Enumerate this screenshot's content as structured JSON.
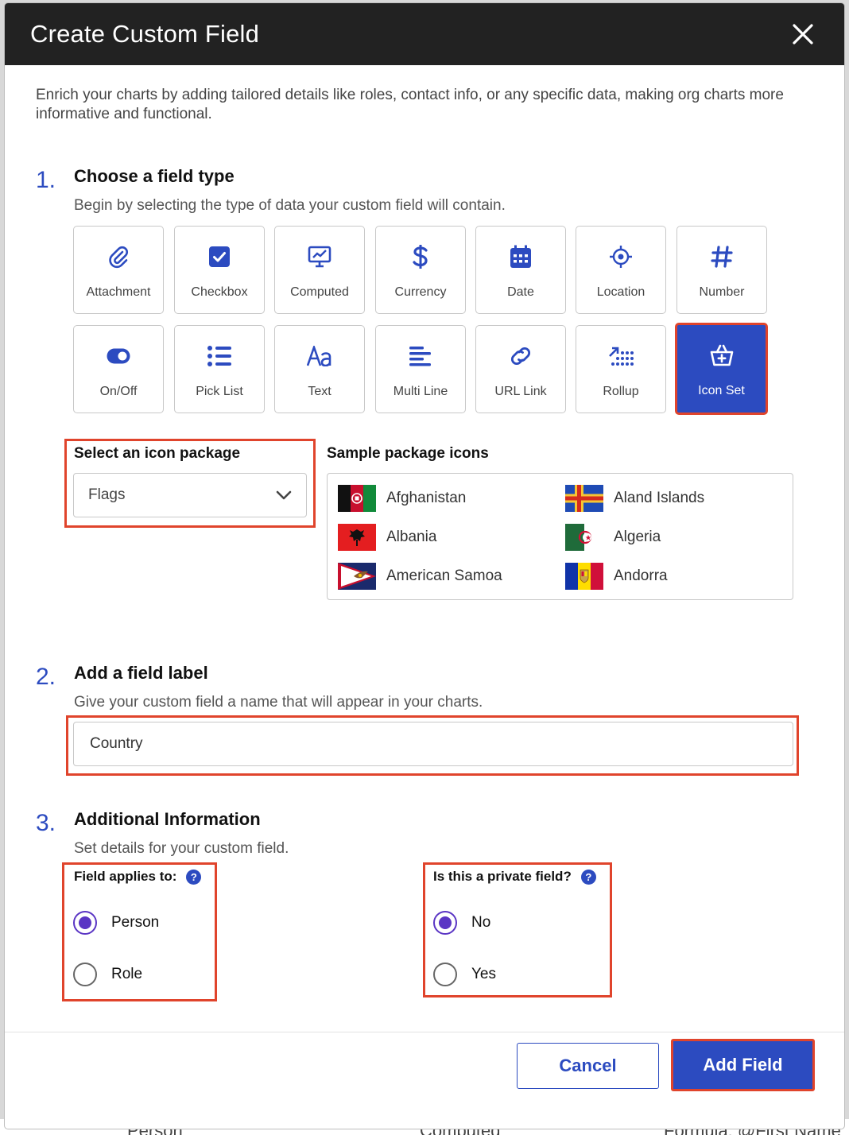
{
  "background": {
    "peek_left": "Person",
    "peek_mid": "Computed",
    "peek_right": "Formula: @First Name"
  },
  "modal": {
    "title": "Create Custom Field",
    "intro": "Enrich your charts by adding tailored details like roles, contact info, or any specific data, making org charts more informative and functional."
  },
  "step1": {
    "number": "1.",
    "title": "Choose a field type",
    "description": "Begin by selecting the type of data your custom field will contain.",
    "field_types": [
      {
        "label": "Attachment",
        "icon": "paperclip-icon"
      },
      {
        "label": "Checkbox",
        "icon": "checkbox-icon"
      },
      {
        "label": "Computed",
        "icon": "monitor-chart-icon"
      },
      {
        "label": "Currency",
        "icon": "dollar-icon"
      },
      {
        "label": "Date",
        "icon": "calendar-icon"
      },
      {
        "label": "Location",
        "icon": "crosshair-icon"
      },
      {
        "label": "Number",
        "icon": "hash-icon"
      },
      {
        "label": "On/Off",
        "icon": "toggle-icon"
      },
      {
        "label": "Pick List",
        "icon": "list-icon"
      },
      {
        "label": "Text",
        "icon": "text-aa-icon"
      },
      {
        "label": "Multi Line",
        "icon": "lines-icon"
      },
      {
        "label": "URL Link",
        "icon": "link-icon"
      },
      {
        "label": "Rollup",
        "icon": "rollup-icon"
      },
      {
        "label": "Icon Set",
        "icon": "basket-icon"
      }
    ],
    "selected_type": "Icon Set",
    "icon_package_label": "Select an icon package",
    "icon_package_value": "Flags",
    "sample_label": "Sample package icons",
    "sample_icons": [
      {
        "name": "Afghanistan",
        "icon": "flag-afghanistan-icon"
      },
      {
        "name": "Aland Islands",
        "icon": "flag-aland-icon"
      },
      {
        "name": "Albania",
        "icon": "flag-albania-icon"
      },
      {
        "name": "Algeria",
        "icon": "flag-algeria-icon"
      },
      {
        "name": "American Samoa",
        "icon": "flag-american-samoa-icon"
      },
      {
        "name": "Andorra",
        "icon": "flag-andorra-icon"
      }
    ]
  },
  "step2": {
    "number": "2.",
    "title": "Add a field label",
    "description": "Give your custom field a name that will appear in your charts.",
    "input_value": "Country"
  },
  "step3": {
    "number": "3.",
    "title": "Additional Information",
    "description": "Set details for your custom field.",
    "applies_label": "Field applies to:",
    "applies_options": [
      "Person",
      "Role"
    ],
    "applies_selected": "Person",
    "private_label": "Is this a private field?",
    "private_options": [
      "No",
      "Yes"
    ],
    "private_selected": "No",
    "help_glyph": "?"
  },
  "footer": {
    "cancel_label": "Cancel",
    "add_label": "Add Field"
  },
  "colors": {
    "accent": "#2c4bc0",
    "highlight": "#e0442c",
    "radio": "#5a35c4",
    "header_bg": "#222222"
  }
}
